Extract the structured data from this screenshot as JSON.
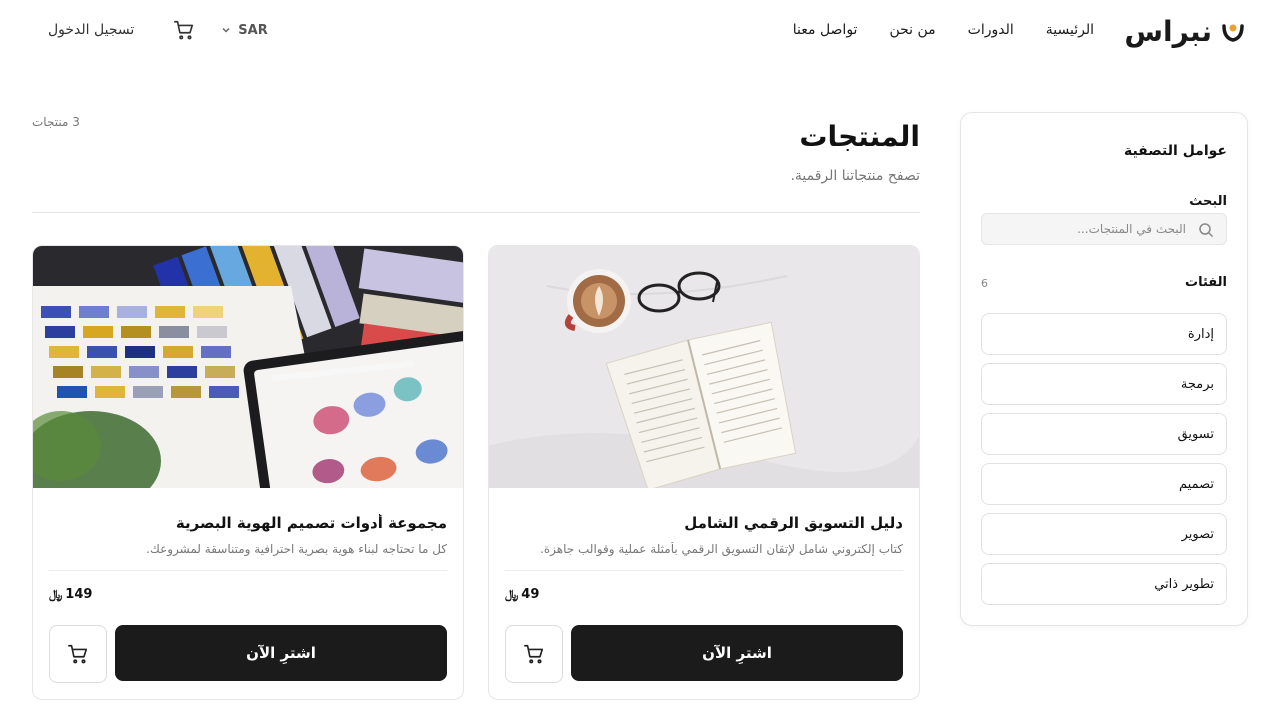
{
  "brand": {
    "name": "نبراس"
  },
  "nav": {
    "items": [
      {
        "label": "الرئيسية"
      },
      {
        "label": "الدورات"
      },
      {
        "label": "من نحن"
      },
      {
        "label": "تواصل معنا"
      }
    ]
  },
  "header": {
    "currency": "SAR",
    "login_label": "تسجيل الدخول"
  },
  "page": {
    "title": "المنتجات",
    "subtitle": "تصفح منتجاتنا الرقمية.",
    "count_label": "3 منتجات"
  },
  "products": [
    {
      "title": "دليل التسويق الرقمي الشامل",
      "description": "كتاب إلكتروني شامل لإتقان التسويق الرقمي بأمثلة عملية وقوالب جاهزة.",
      "price": "49",
      "currency_symbol": "⃁",
      "buy_label": "اشترِ الآن",
      "image": "open-book-coffee-glasses"
    },
    {
      "title": "مجموعة أدوات تصميم الهوية البصرية",
      "description": "كل ما تحتاجه لبناء هوية بصرية احترافية ومتناسقة لمشروعك.",
      "price": "149",
      "currency_symbol": "⃁",
      "buy_label": "اشترِ الآن",
      "image": "color-swatches-tablet"
    }
  ],
  "sidebar": {
    "title": "عوامل التصفية",
    "search_label": "البحث",
    "search_placeholder": "البحث في المنتجات...",
    "categories_label": "الفئات",
    "categories_count": "6",
    "categories": [
      {
        "label": "إدارة"
      },
      {
        "label": "برمجة"
      },
      {
        "label": "تسويق"
      },
      {
        "label": "تصميم"
      },
      {
        "label": "تصوير"
      },
      {
        "label": "تطوير ذاتي"
      }
    ]
  },
  "colors": {
    "primary_button": "#1b1b1b",
    "border": "#e4e4e4",
    "muted_text": "#777777"
  }
}
